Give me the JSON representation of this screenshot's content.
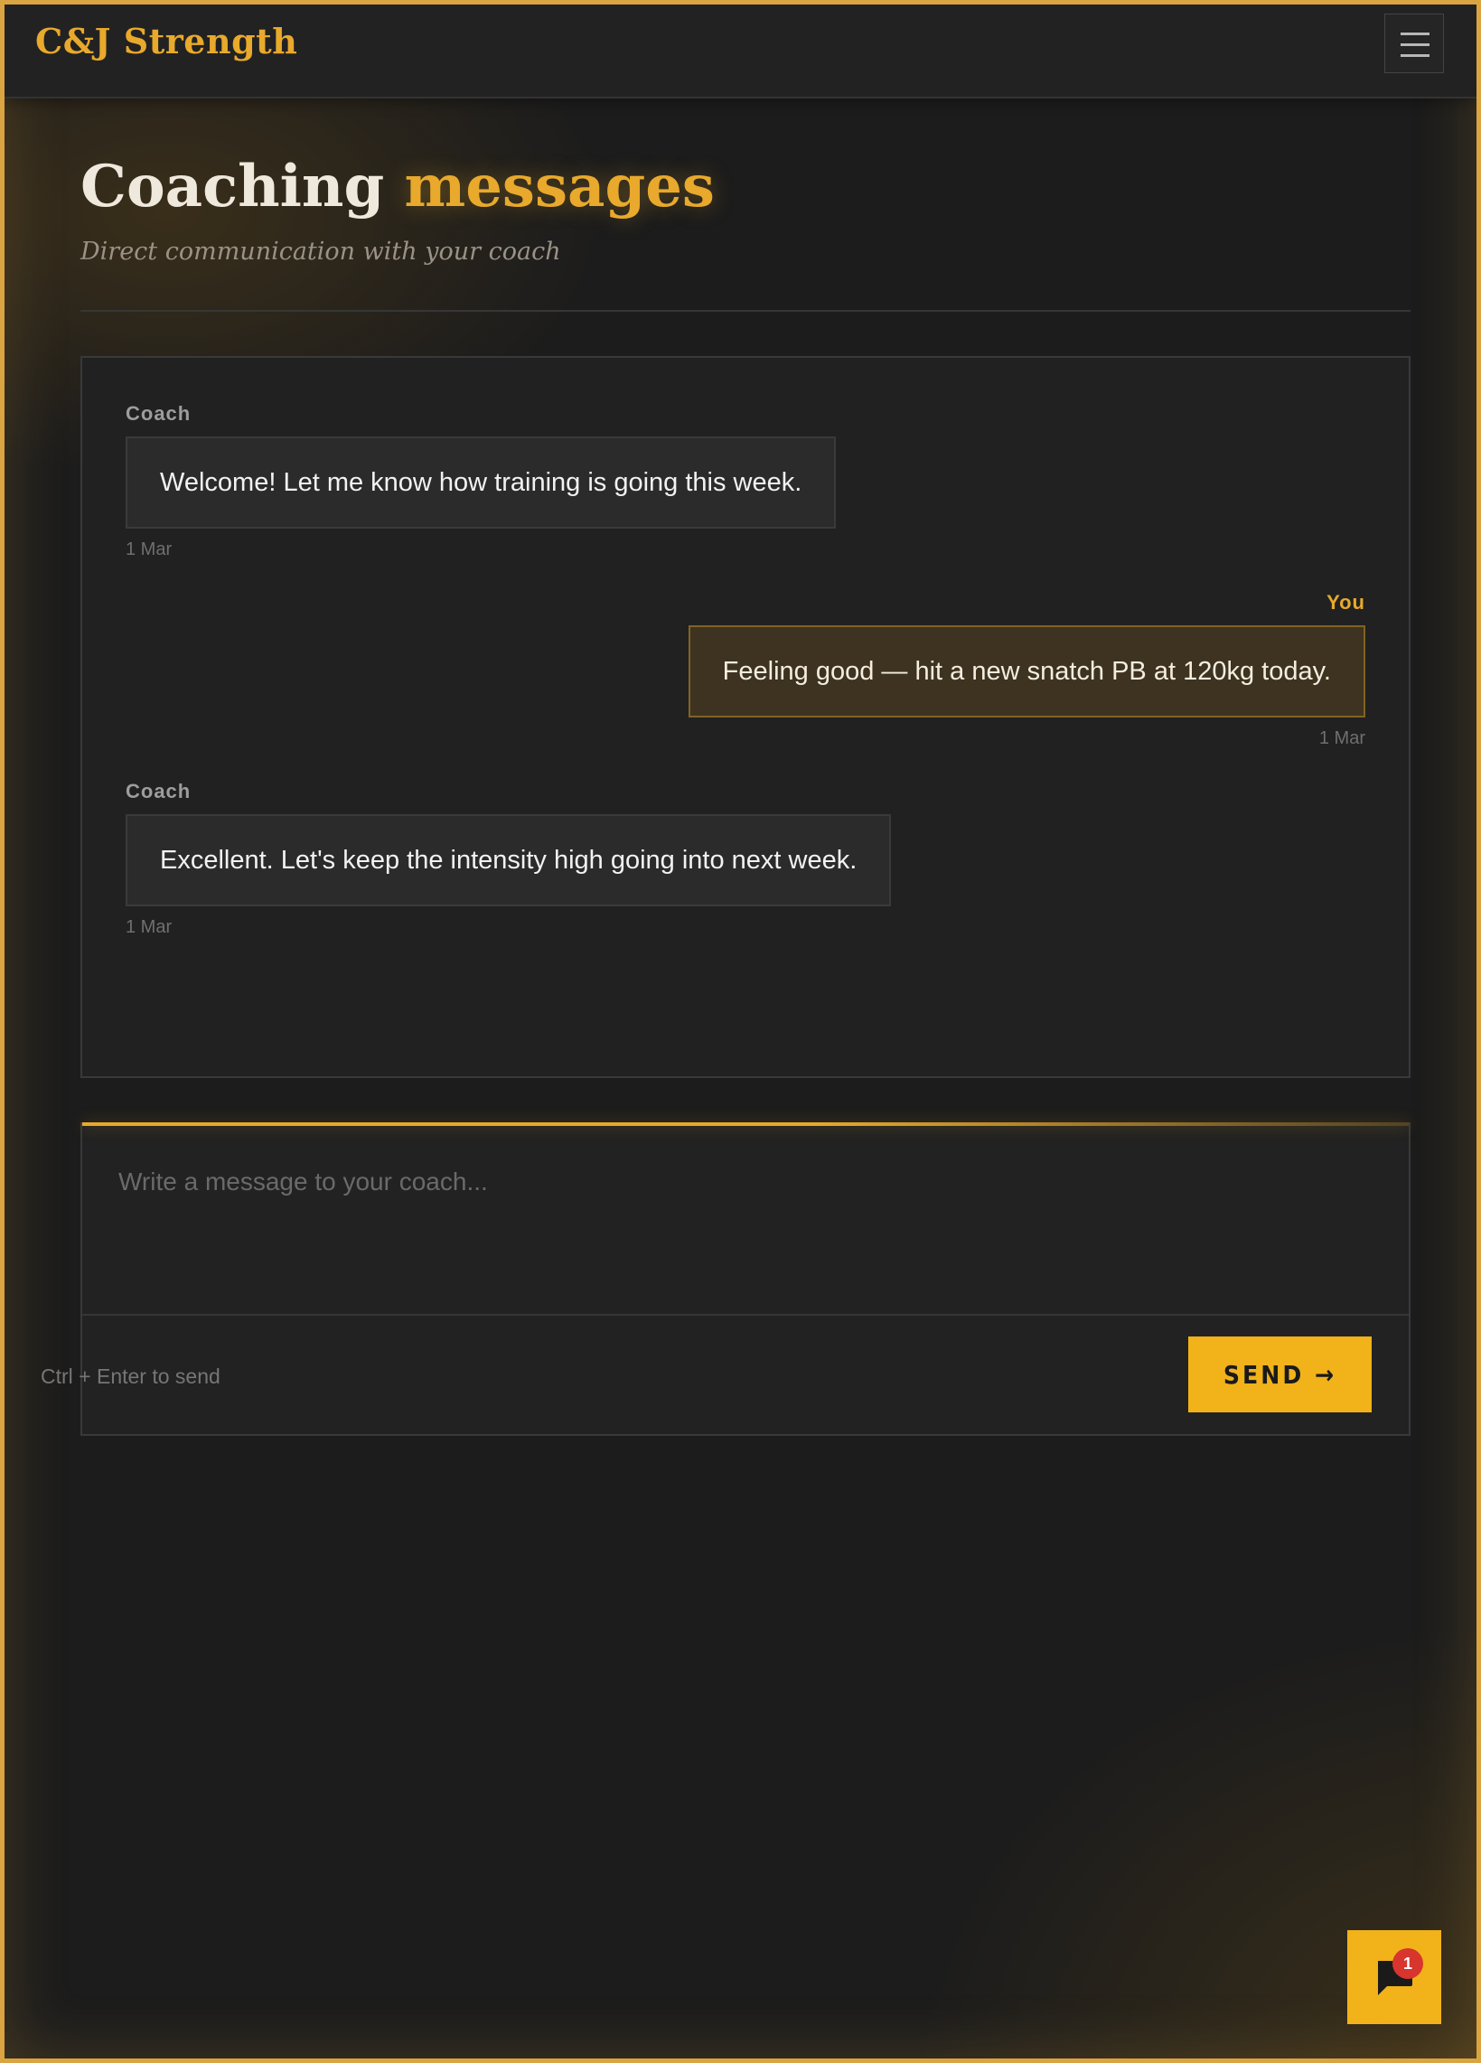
{
  "app": {
    "brand": "C&J Strength"
  },
  "header": {
    "title_main": "Coaching ",
    "title_accent": "messages",
    "subtitle": "Direct communication with your coach"
  },
  "thread": {
    "messages": [
      {
        "sender": "Coach",
        "text": "Welcome! Let me know how training is going this week.",
        "time": "1 Mar"
      },
      {
        "sender": "You",
        "text": "Feeling good — hit a new snatch PB at 120kg today.",
        "time": "1 Mar"
      },
      {
        "sender": "Coach",
        "text": "Excellent. Let's keep the intensity high going into next week.",
        "time": "1 Mar"
      }
    ]
  },
  "composer": {
    "placeholder": "Write a message to your coach...",
    "value": "",
    "hint": "Ctrl + Enter to send",
    "send_label": "SEND →"
  },
  "fab": {
    "icon": "chat-bubble-icon",
    "badge_count": "1"
  },
  "colors": {
    "accent": "#e8a92c",
    "button": "#f1b21a",
    "badge": "#d7352e",
    "background": "#1c1c1c"
  }
}
